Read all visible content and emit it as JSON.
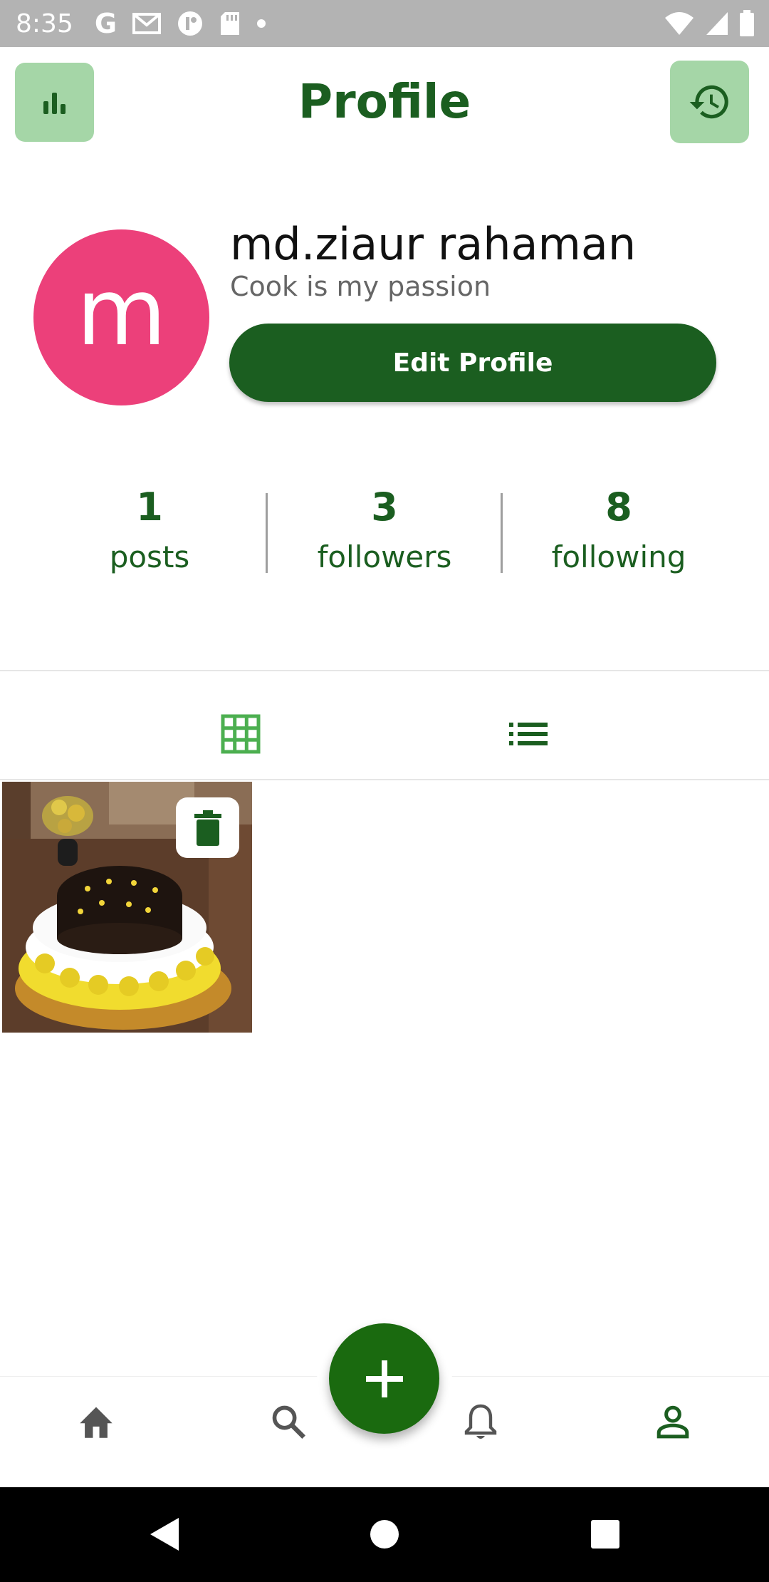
{
  "status_bar": {
    "time": "8:35"
  },
  "header": {
    "title": "Profile",
    "left_icon": "bar-chart-icon",
    "right_icon": "history-icon"
  },
  "profile": {
    "avatar_letter": "m",
    "avatar_color": "#ec407a",
    "name": "md.ziaur rahaman",
    "bio": "Cook is my passion",
    "edit_button": "Edit Profile"
  },
  "stats": [
    {
      "value": "1",
      "label": "posts"
    },
    {
      "value": "3",
      "label": "followers"
    },
    {
      "value": "8",
      "label": "following"
    }
  ],
  "tabs": [
    {
      "icon": "grid-icon",
      "active": true
    },
    {
      "icon": "list-icon",
      "active": false
    }
  ],
  "posts": [
    {
      "image": "cake-photo",
      "delete_icon": "trash-icon"
    }
  ],
  "bottom_nav": [
    {
      "icon": "home-icon"
    },
    {
      "icon": "search-icon"
    },
    {
      "icon": "add-icon"
    },
    {
      "icon": "bell-icon"
    },
    {
      "icon": "person-icon",
      "active": true
    }
  ],
  "colors": {
    "primary": "#1b5e20",
    "accent_light": "#a5d6a7",
    "fab": "#1a6a0f"
  }
}
